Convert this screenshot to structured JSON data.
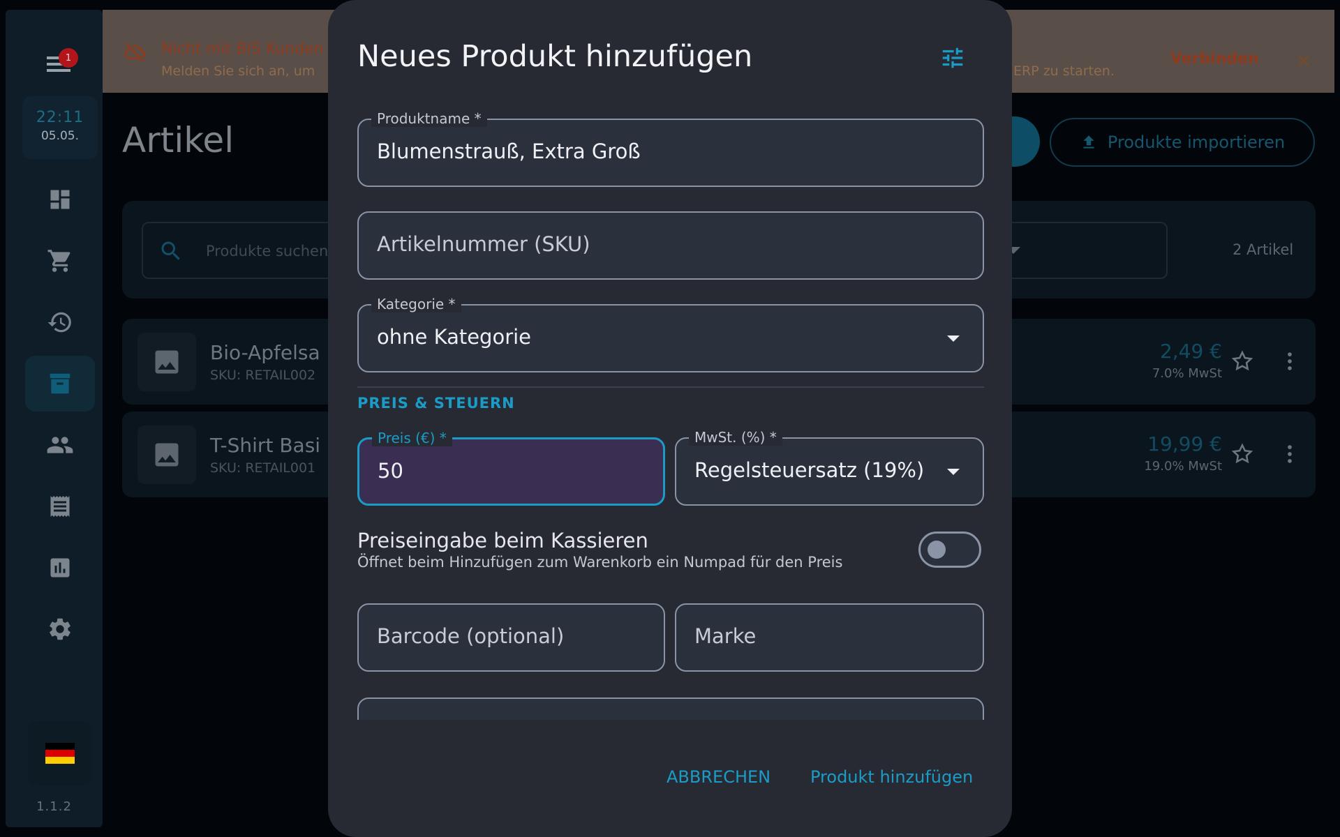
{
  "sidebar": {
    "notification_count": "1",
    "clock_time": "22:11",
    "clock_date": "05.05.",
    "nav_items": [
      "dashboard-icon",
      "cart-icon",
      "history-icon",
      "archive-icon",
      "people-icon",
      "receipt-icon",
      "bar-chart-icon",
      "gear-icon"
    ],
    "active_item": "archive-icon",
    "language_flag": "🇩🇪",
    "version": "1.1.2"
  },
  "banner": {
    "title": "Nicht mit BIS Kunden",
    "text_start": "Melden Sie sich an, um",
    "text_end": "ERP zu starten.",
    "connect_label": "Verbinden",
    "close_glyph": "×"
  },
  "page": {
    "title": "Artikel",
    "import_label": "Produkte importieren",
    "search_placeholder": "Produkte suchen",
    "count_label": "2 Artikel"
  },
  "products": [
    {
      "name": "Bio-Apfelsa",
      "sku": "SKU: RETAIL002",
      "price": "2,49 €",
      "tax": "7.0% MwSt"
    },
    {
      "name": "T-Shirt Basi",
      "sku": "SKU: RETAIL001",
      "price": "19,99 €",
      "tax": "19.0% MwSt"
    }
  ],
  "modal": {
    "title": "Neues Produkt hinzufügen",
    "product_name": {
      "label": "Produktname *",
      "value": "Blumenstrauß, Extra Groß"
    },
    "sku": {
      "placeholder": "Artikelnummer (SKU)"
    },
    "category": {
      "label": "Kategorie *",
      "value": "ohne Kategorie"
    },
    "section_title": "PREIS & STEUERN",
    "price": {
      "label": "Preis (€) *",
      "value": "50"
    },
    "vat": {
      "label": "MwSt. (%) *",
      "value": "Regelsteuersatz (19%)"
    },
    "price_entry": {
      "title": "Preiseingabe beim Kassieren",
      "description": "Öffnet beim Hinzufügen zum Warenkorb ein Numpad für den Preis",
      "enabled": false
    },
    "barcode": {
      "placeholder": "Barcode (optional)"
    },
    "brand": {
      "placeholder": "Marke"
    },
    "cancel_label": "ABBRECHEN",
    "submit_label": "Produkt hinzufügen"
  },
  "colors": {
    "accent": "#1b9cc7",
    "modal_bg": "#282a33",
    "field_border": "#8b93a7",
    "focus_fill": "#3a2f52"
  }
}
